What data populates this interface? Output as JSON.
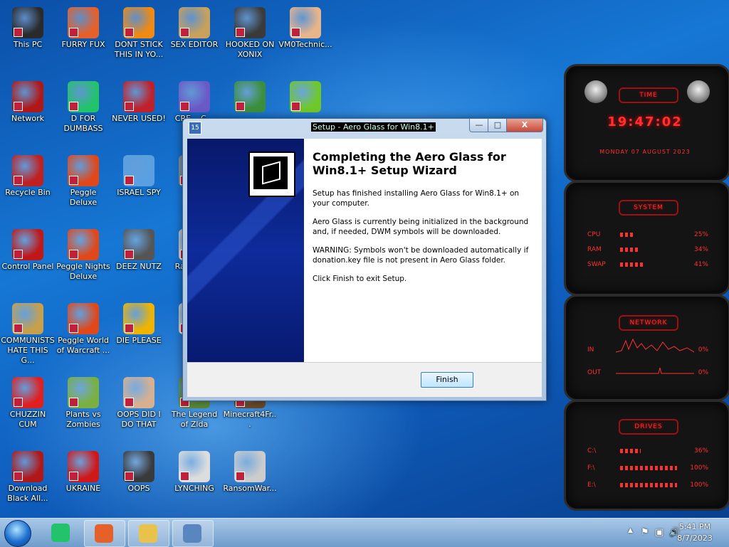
{
  "desktop_icons": [
    {
      "label": "This PC",
      "icon": "monitor-icon",
      "color": "#2a2a2a"
    },
    {
      "label": "FURRY FUX",
      "icon": "firefox-icon",
      "color": "#e6602a"
    },
    {
      "label": "DONT STICK THIS IN YO...",
      "icon": "vlc-cone-icon",
      "color": "#f08a12"
    },
    {
      "label": "SEX EDITOR",
      "icon": "hxd-editor-icon",
      "color": "#c9a15a"
    },
    {
      "label": "HOOKED ON XONIX",
      "icon": "game-icon",
      "color": "#3a3a3a"
    },
    {
      "label": "VM0Technic...",
      "icon": "doctor-icon",
      "color": "#e8b48a"
    },
    {
      "label": "Network",
      "icon": "network-icon",
      "color": "#b01818"
    },
    {
      "label": "D FOR DUMBASS",
      "icon": "chat-icon",
      "color": "#22c36a"
    },
    {
      "label": "NEVER USED!",
      "icon": "devcpp-icon",
      "color": "#c0202a"
    },
    {
      "label": "CRE... C...",
      "icon": "card-icon",
      "color": "#6a5ac8"
    },
    {
      "label": "",
      "icon": "elf-icon",
      "color": "#3b8f3b"
    },
    {
      "label": "",
      "icon": "lime-icon",
      "color": "#6fc82a"
    },
    {
      "label": "Recycle Bin",
      "icon": "recycle-bin-icon",
      "color": "#c02020"
    },
    {
      "label": "Peggle Deluxe",
      "icon": "peggle-icon",
      "color": "#e0481a"
    },
    {
      "label": "ISRAEL SPY",
      "icon": "spy-network-icon",
      "color": "#5aa0e0"
    },
    {
      "label": "2P...",
      "icon": "app-icon",
      "color": "#888888"
    },
    {
      "label": "Control Panel",
      "icon": "control-panel-icon",
      "color": "#c01818"
    },
    {
      "label": "Peggle Nights Deluxe",
      "icon": "peggle-nights-icon",
      "color": "#e0481a"
    },
    {
      "label": "DEEZ NUTZ",
      "icon": "stack-icon",
      "color": "#555555"
    },
    {
      "label": "Ra... Ma...",
      "icon": "app-icon",
      "color": "#cccccc"
    },
    {
      "label": "COMMUNISTS HATE THIS G...",
      "icon": "money-bag-icon",
      "color": "#c8a04a"
    },
    {
      "label": "Peggle World of Warcraft ...",
      "icon": "peggle-wow-icon",
      "color": "#e0481a"
    },
    {
      "label": "DIE PLEASE",
      "icon": "de-icon",
      "color": "#f0b400"
    },
    {
      "label": "S...",
      "icon": "app-icon",
      "color": "#cccccc"
    },
    {
      "label": "CHUZZIN CUM",
      "icon": "chuzzle-icon",
      "color": "#e02020"
    },
    {
      "label": "Plants vs Zombies",
      "icon": "plant-icon",
      "color": "#7ab040"
    },
    {
      "label": "OOPS DID I DO THAT",
      "icon": "portrait-icon",
      "color": "#d8b090"
    },
    {
      "label": "The Legend of Zlda",
      "icon": "zelda-icon",
      "color": "#5a8a3a"
    },
    {
      "label": "Minecraft4Fr...",
      "icon": "minecraft-icon",
      "color": "#6a4a2a"
    },
    {
      "label": "Download Black All...",
      "icon": "network-icon",
      "color": "#b01818"
    },
    {
      "label": "UKRAINE",
      "icon": "radiation-icon",
      "color": "#d01818"
    },
    {
      "label": "OOPS",
      "icon": "frame-icon",
      "color": "#3a3a3a"
    },
    {
      "label": "LYNCHING",
      "icon": "noose-icon",
      "color": "#dddddd"
    },
    {
      "label": "RansomWar...",
      "icon": "skull-icon",
      "color": "#cccccc"
    }
  ],
  "dialog": {
    "title": "Setup - Aero Glass for Win8.1+",
    "heading": "Completing the Aero Glass for Win8.1+ Setup Wizard",
    "paragraphs": [
      "Setup has finished installing Aero Glass for Win8.1+ on your computer.",
      "Aero Glass is currently being initialized in the background and, if needed, DWM symbols will be downloaded.",
      "WARNING: Symbols won't be downloaded automatically if donation.key file is not present in Aero Glass folder.",
      "Click Finish to exit Setup."
    ],
    "finish_label": "Finish",
    "min_glyph": "—",
    "max_glyph": "□",
    "close_glyph": "X",
    "app_icon_text": "15"
  },
  "gadgets": {
    "time": {
      "header": "TIME",
      "clock": "19:47:02",
      "date": "MONDAY 07 AUGUST 2023"
    },
    "system": {
      "header": "SYSTEM",
      "rows": [
        {
          "label": "CPU",
          "value": "25%",
          "level": 0.25
        },
        {
          "label": "RAM",
          "value": "34%",
          "level": 0.34
        },
        {
          "label": "SWAP",
          "value": "41%",
          "level": 0.41
        }
      ]
    },
    "network": {
      "header": "NETWORK",
      "rows": [
        {
          "label": "IN",
          "value": "0%"
        },
        {
          "label": "OUT",
          "value": "0%"
        }
      ]
    },
    "drives": {
      "header": "DRIVES",
      "rows": [
        {
          "label": "C:\\",
          "value": "36%",
          "level": 0.36
        },
        {
          "label": "F:\\",
          "value": "100%",
          "level": 1.0
        },
        {
          "label": "E:\\",
          "value": "100%",
          "level": 1.0
        }
      ]
    }
  },
  "taskbar": {
    "items": [
      {
        "name": "taskbar-chat",
        "color": "#22c36a"
      },
      {
        "name": "taskbar-firefox",
        "color": "#e6602a"
      },
      {
        "name": "taskbar-explorer",
        "color": "#e8c24a"
      },
      {
        "name": "taskbar-setup",
        "color": "#5a86c0"
      }
    ],
    "time": "5:41 PM",
    "date": "8/7/2023",
    "tray_glyphs": {
      "chevron": "▲",
      "flag": "⚑",
      "network": "▣",
      "volume": "🔊"
    }
  }
}
